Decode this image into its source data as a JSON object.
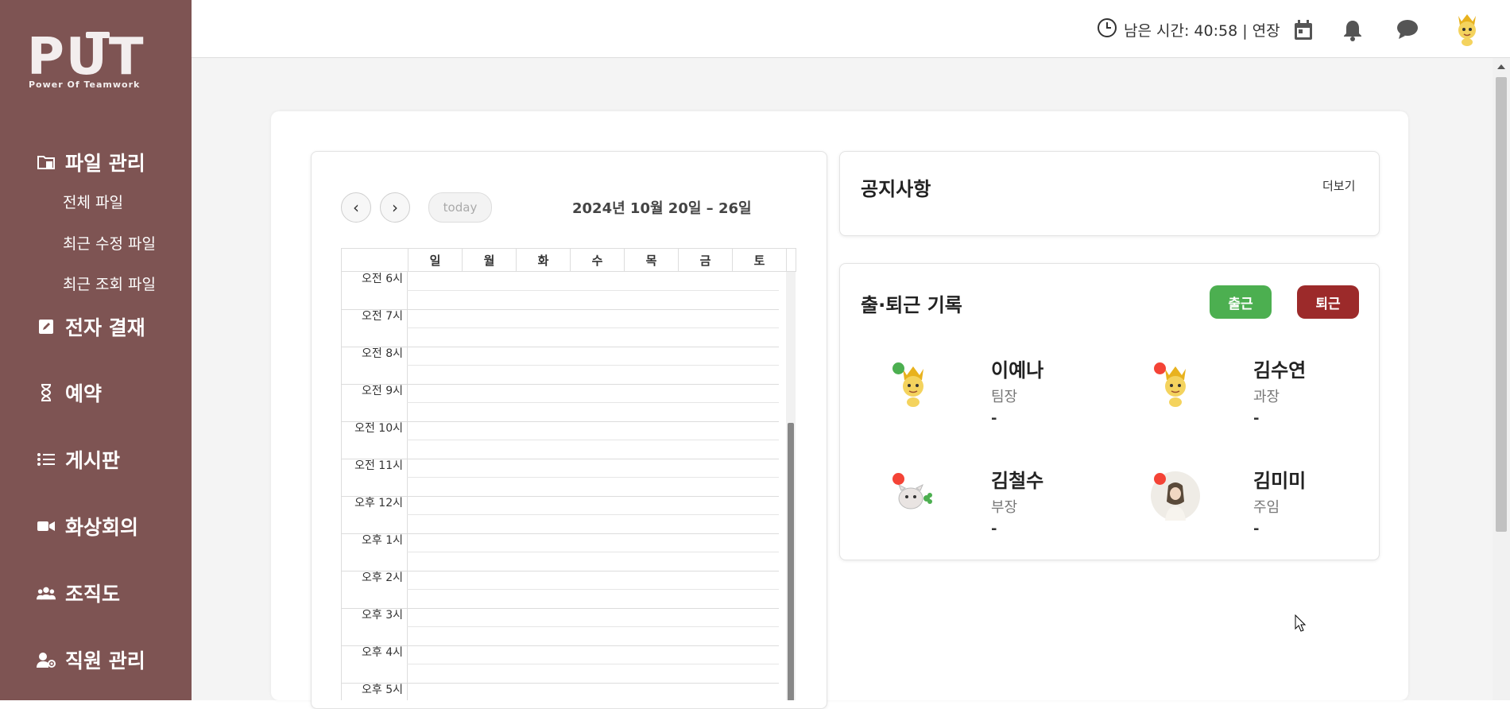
{
  "logo": {
    "big": "PUT",
    "small": "Power Of Teamwork"
  },
  "sidebar": {
    "file_manage": "파일 관리",
    "file_subitems": [
      "전체 파일",
      "최근 수정 파일",
      "최근 조회 파일"
    ],
    "approval": "전자 결재",
    "reservation": "예약",
    "board": "게시판",
    "video_meeting": "화상회의",
    "org_chart": "조직도",
    "staff_manage": "직원 관리"
  },
  "header": {
    "timer_label": "남은 시간: 40:58 | 연장",
    "icons": [
      "calendar-icon",
      "bell-icon",
      "chat-icon",
      "profile-avatar"
    ]
  },
  "calendar": {
    "prev": "‹",
    "next": "›",
    "today": "today",
    "title": "2024년 10월 20일 – 26일",
    "days": [
      "일",
      "월",
      "화",
      "수",
      "목",
      "금",
      "토"
    ],
    "times": [
      "오전 6시",
      "오전 7시",
      "오전 8시",
      "오전 9시",
      "오전 10시",
      "오전 11시",
      "오후 12시",
      "오후 1시",
      "오후 2시",
      "오후 3시",
      "오후 4시",
      "오후 5시"
    ]
  },
  "notice": {
    "title": "공지사항",
    "more": "더보기"
  },
  "attendance": {
    "title": "출·퇴근 기록",
    "clock_in": "출근",
    "clock_out": "퇴근",
    "members": [
      {
        "name": "이예나",
        "role": "팀장",
        "time": "-",
        "status": "online",
        "status_color": "#4caf50"
      },
      {
        "name": "김수연",
        "role": "과장",
        "time": "-",
        "status": "offline",
        "status_color": "#f44336"
      },
      {
        "name": "김철수",
        "role": "부장",
        "time": "-",
        "status": "offline",
        "status_color": "#f44336"
      },
      {
        "name": "김미미",
        "role": "주임",
        "time": "-",
        "status": "offline",
        "status_color": "#f44336"
      }
    ]
  },
  "colors": {
    "sidebar": "#7e5453",
    "clock_in": "#4caf50",
    "clock_out": "#9c2a2a",
    "background": "#f4f4f4"
  }
}
